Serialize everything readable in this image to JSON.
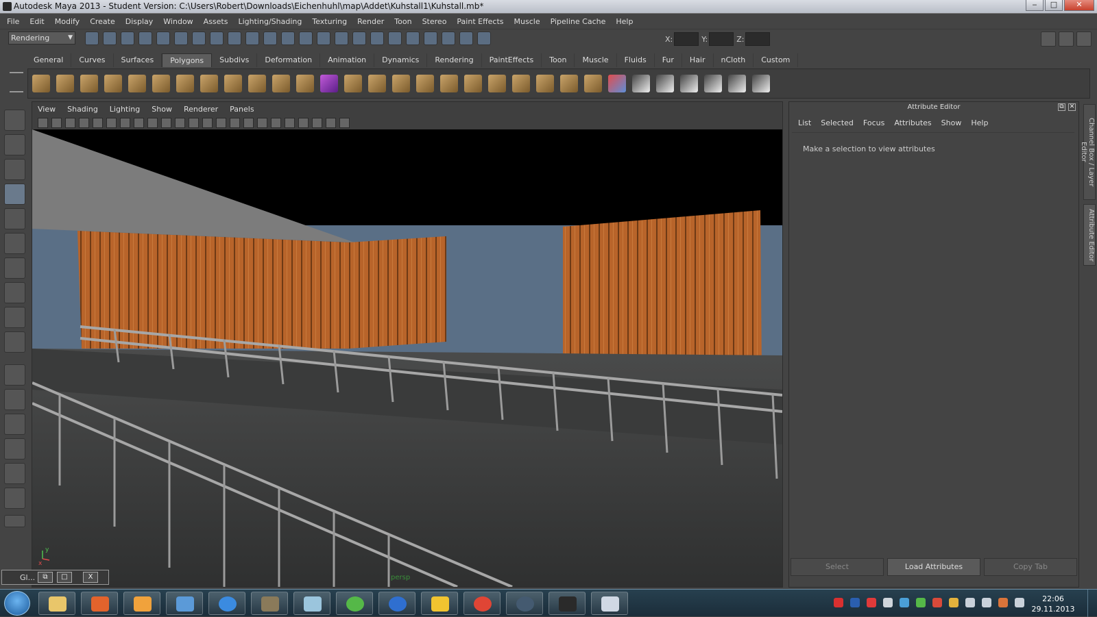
{
  "window": {
    "title": "Autodesk Maya 2013 - Student Version: C:\\Users\\Robert\\Downloads\\Eichenhuhl\\map\\Addet\\Kuhstall1\\Kuhstall.mb*",
    "minimize": "‒",
    "maximize": "□",
    "close": "✕"
  },
  "menubar": [
    "File",
    "Edit",
    "Modify",
    "Create",
    "Display",
    "Window",
    "Assets",
    "Lighting/Shading",
    "Texturing",
    "Render",
    "Toon",
    "Stereo",
    "Paint Effects",
    "Muscle",
    "Pipeline Cache",
    "Help"
  ],
  "statusline": {
    "mode": "Rendering",
    "x_label": "X:",
    "y_label": "Y:",
    "z_label": "Z:",
    "x_value": "",
    "y_value": "",
    "z_value": ""
  },
  "shelf": {
    "tabs": [
      "General",
      "Curves",
      "Surfaces",
      "Polygons",
      "Subdivs",
      "Deformation",
      "Animation",
      "Dynamics",
      "Rendering",
      "PaintEffects",
      "Toon",
      "Muscle",
      "Fluids",
      "Fur",
      "Hair",
      "nCloth",
      "Custom"
    ],
    "active_tab": "Polygons"
  },
  "viewport": {
    "menus": [
      "View",
      "Shading",
      "Lighting",
      "Show",
      "Renderer",
      "Panels"
    ],
    "camera_label": "persp",
    "axis_y": "y",
    "axis_x": "x"
  },
  "gl_window": {
    "label": "Gl...",
    "close": "X"
  },
  "attribute_editor": {
    "title": "Attribute Editor",
    "menus": [
      "List",
      "Selected",
      "Focus",
      "Attributes",
      "Show",
      "Help"
    ],
    "message": "Make a selection to view attributes",
    "buttons": {
      "select": "Select",
      "load": "Load Attributes",
      "copy": "Copy Tab"
    }
  },
  "side_tabs": [
    "Channel Box / Layer Editor",
    "Attribute Editor"
  ],
  "taskbar": {
    "time": "22:06",
    "date": "29.11.2013"
  },
  "colors": {
    "ui_bg": "#444444",
    "wood": "#b8642a",
    "sky": "#5a6f86",
    "floor": "#3c3d3d"
  }
}
